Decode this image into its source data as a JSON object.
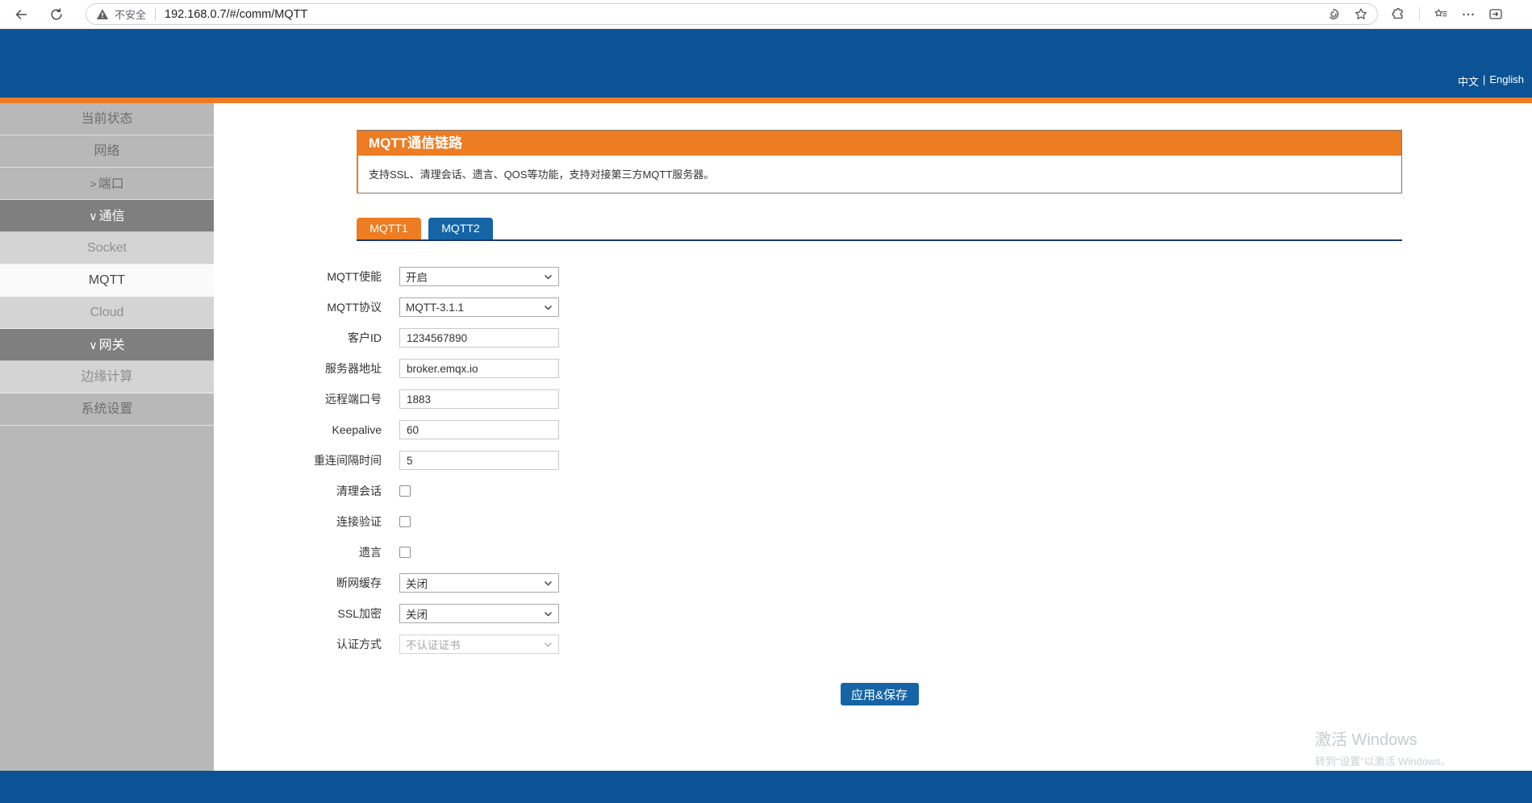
{
  "browser": {
    "security_label": "不安全",
    "url": "192.168.0.7/#/comm/MQTT"
  },
  "header": {
    "lang_zh": "中文",
    "lang_separator": "|",
    "lang_en": "English"
  },
  "sidebar": {
    "items": [
      {
        "label": "当前状态",
        "type": "item"
      },
      {
        "label": "网络",
        "type": "item"
      },
      {
        "label": "端口",
        "prefix": ">",
        "type": "group-collapsed"
      },
      {
        "label": "通信",
        "prefix": "∨",
        "type": "group-expanded"
      },
      {
        "label": "Socket",
        "type": "subitem"
      },
      {
        "label": "MQTT",
        "type": "subitem-selected"
      },
      {
        "label": "Cloud",
        "type": "subitem"
      },
      {
        "label": "网关",
        "prefix": "∨",
        "type": "group-expanded"
      },
      {
        "label": "边缘计算",
        "type": "subitem"
      },
      {
        "label": "系统设置",
        "type": "item"
      }
    ]
  },
  "main": {
    "panel_title": "MQTT通信链路",
    "panel_desc": "支持SSL、清理会话、遗言、QOS等功能，支持对接第三方MQTT服务器。",
    "tabs": [
      {
        "label": "MQTT1",
        "active": true
      },
      {
        "label": "MQTT2",
        "active": false
      }
    ],
    "form": {
      "fields": [
        {
          "label": "MQTT使能",
          "type": "select",
          "value": "开启"
        },
        {
          "label": "MQTT协议",
          "type": "select",
          "value": "MQTT-3.1.1"
        },
        {
          "label": "客户ID",
          "type": "input",
          "value": "1234567890"
        },
        {
          "label": "服务器地址",
          "type": "input",
          "value": "broker.emqx.io"
        },
        {
          "label": "远程端口号",
          "type": "input",
          "value": "1883"
        },
        {
          "label": "Keepalive",
          "type": "input",
          "value": "60"
        },
        {
          "label": "重连间隔时间",
          "type": "input",
          "value": "5"
        },
        {
          "label": "清理会话",
          "type": "checkbox",
          "checked": false
        },
        {
          "label": "连接验证",
          "type": "checkbox",
          "checked": false
        },
        {
          "label": "遗言",
          "type": "checkbox",
          "checked": false
        },
        {
          "label": "断网缓存",
          "type": "select",
          "value": "关闭"
        },
        {
          "label": "SSL加密",
          "type": "select",
          "value": "关闭"
        },
        {
          "label": "认证方式",
          "type": "select",
          "value": "不认证证书",
          "disabled": true
        }
      ]
    },
    "apply_label": "应用&保存"
  },
  "watermark": {
    "line1": "激活 Windows",
    "line2": "转到“设置”以激活 Windows。"
  }
}
